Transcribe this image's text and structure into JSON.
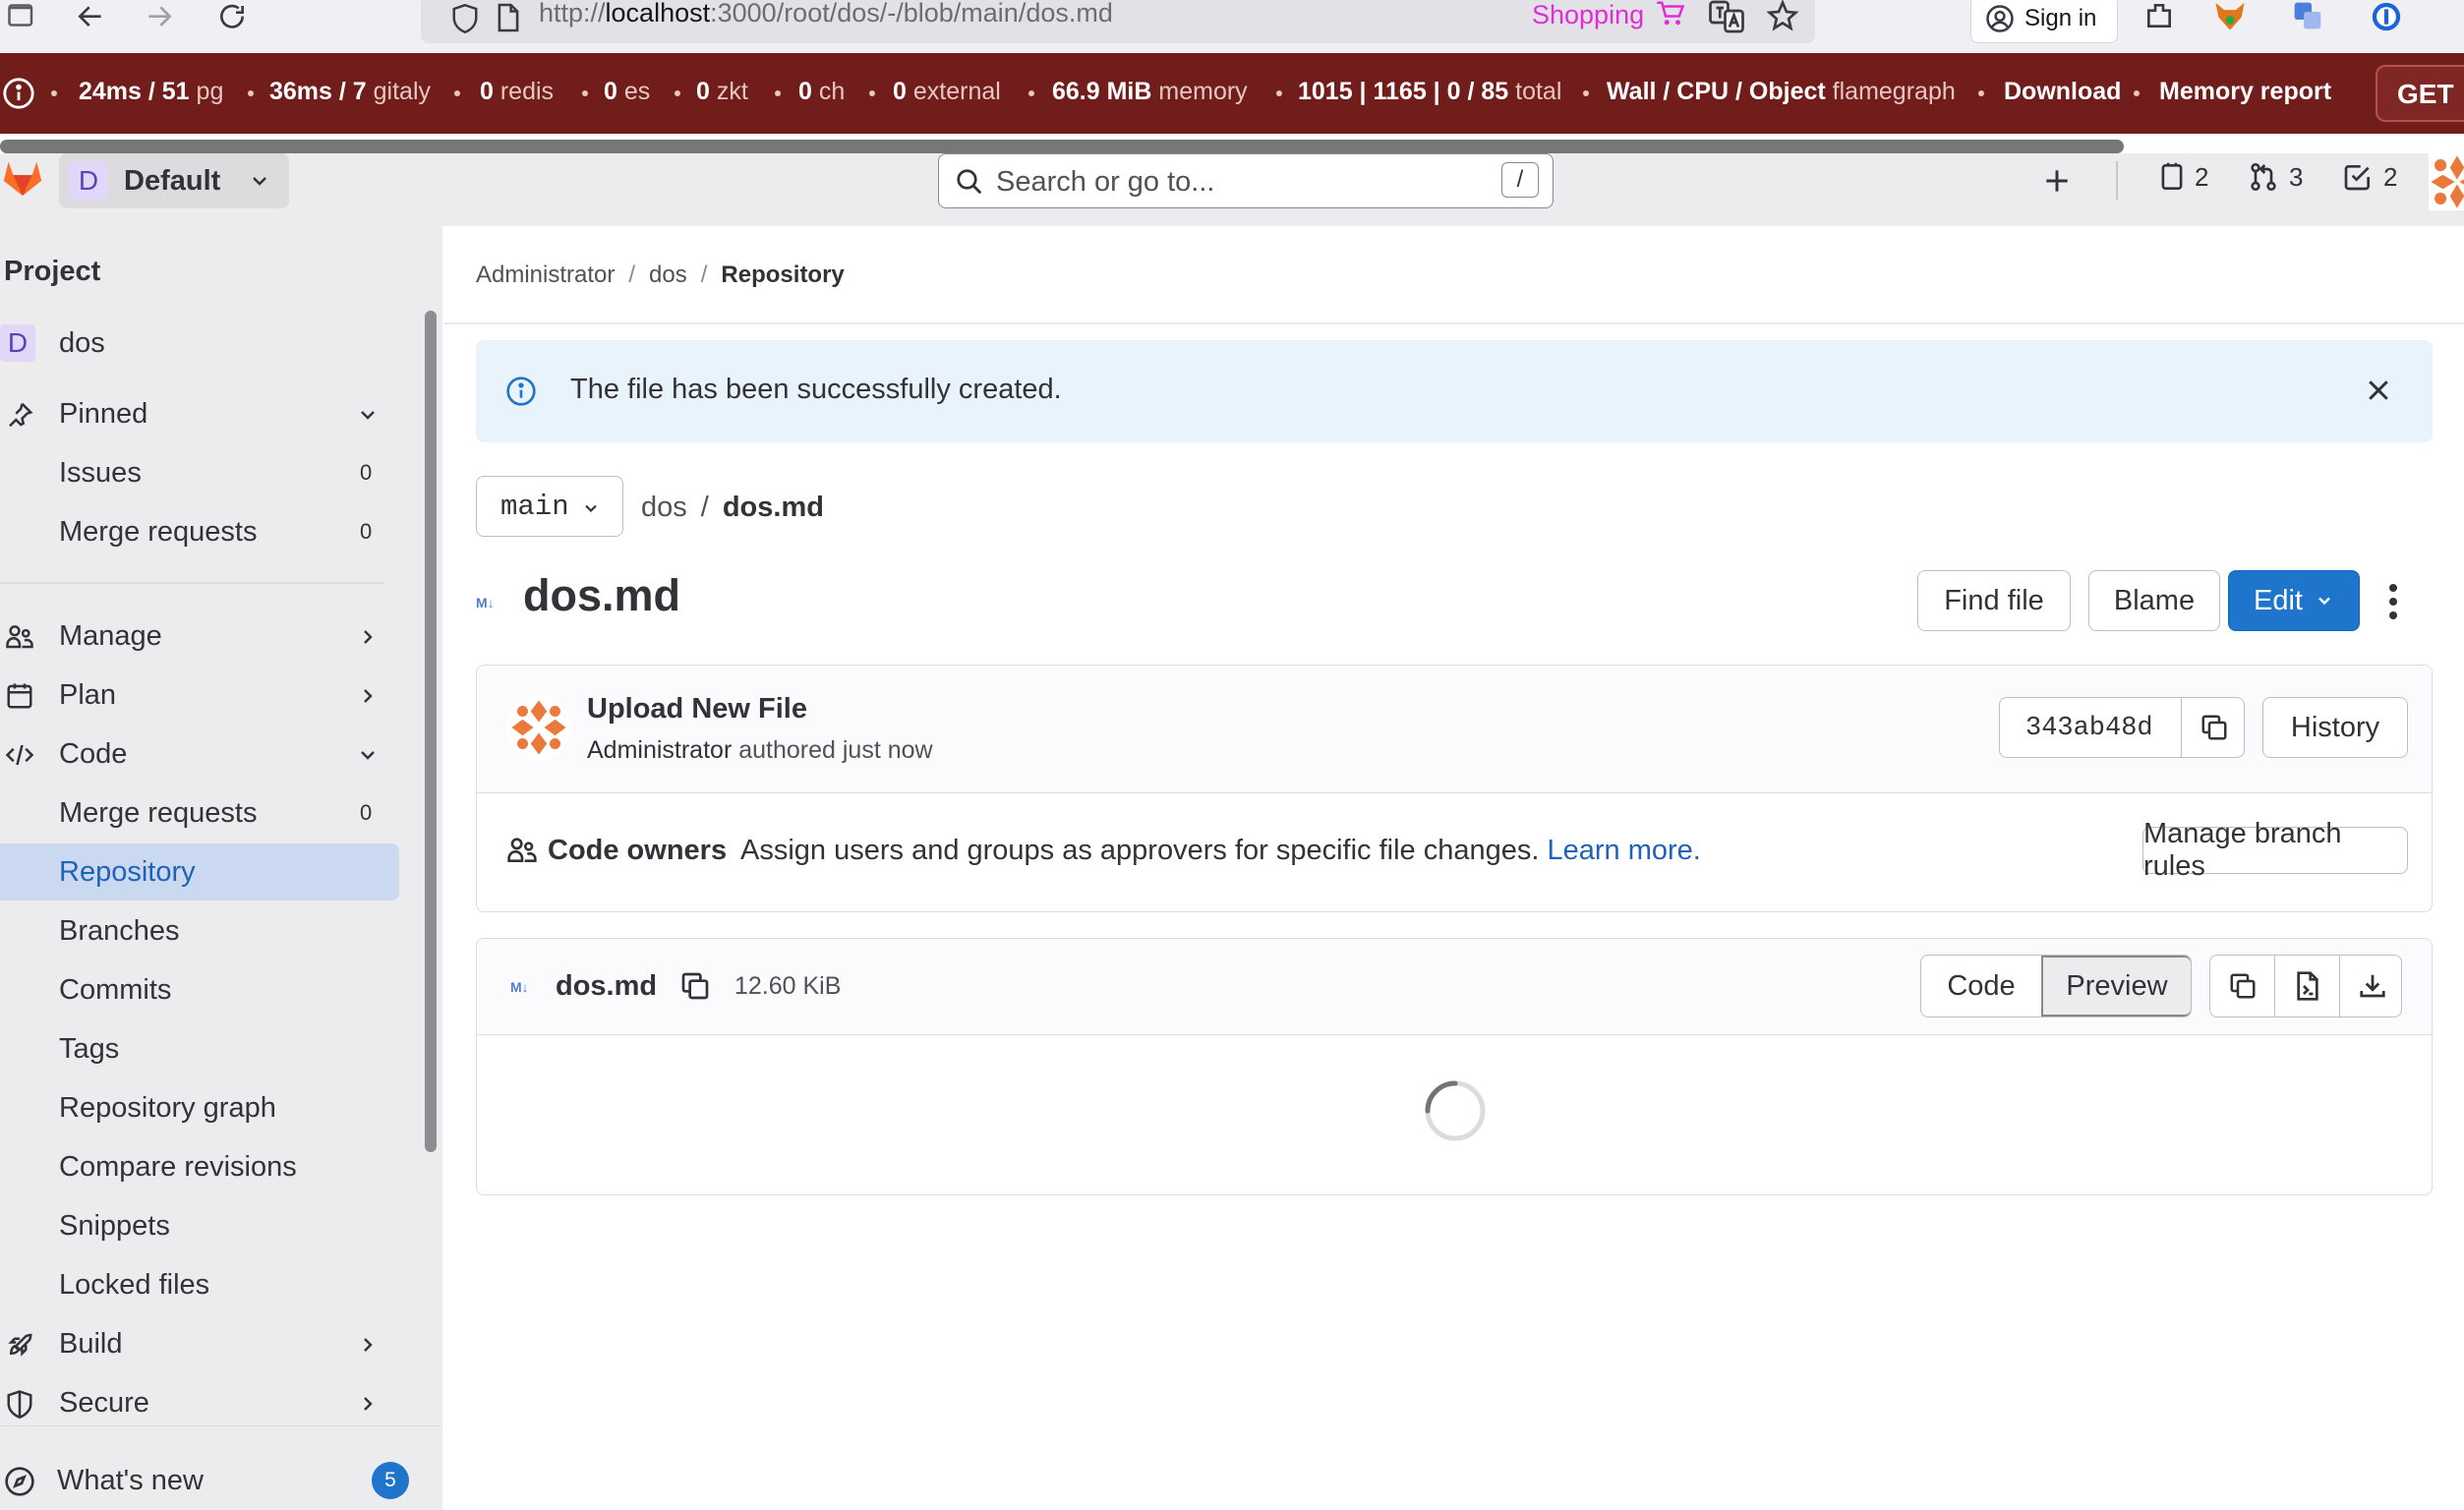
{
  "browser": {
    "url_prefix": "http://",
    "url_host": "localhost",
    "url_rest": ":3000/root/dos/-/blob/main/dos.md",
    "shopping_label": "Shopping",
    "signin_label": "Sign in"
  },
  "perf_bar": {
    "items": [
      {
        "bold": "24ms / 51",
        "muted": "pg"
      },
      {
        "bold": "36ms / 7",
        "muted": "gitaly"
      },
      {
        "bold": "0",
        "muted": "redis"
      },
      {
        "bold": "0",
        "muted": "es"
      },
      {
        "bold": "0",
        "muted": "zkt"
      },
      {
        "bold": "0",
        "muted": "ch"
      },
      {
        "bold": "0",
        "muted": "external"
      },
      {
        "bold": "66.9 MiB",
        "muted": "memory"
      },
      {
        "bold": "1015 | 1165 | 0 / 85",
        "muted": "total"
      },
      {
        "bold": "Wall / CPU / Object",
        "muted": "flamegraph"
      },
      {
        "bold": "Download",
        "muted": ""
      },
      {
        "bold": "Memory report",
        "muted": ""
      }
    ],
    "get_label": "GET"
  },
  "topbar": {
    "context_avatar": "D",
    "context_label": "Default",
    "search_placeholder": "Search or go to...",
    "search_shortcut": "/",
    "issues_count": "2",
    "mr_count": "3",
    "todo_count": "2"
  },
  "sidebar": {
    "heading": "Project",
    "project_avatar": "D",
    "project_name": "dos",
    "pinned_label": "Pinned",
    "pinned_items": [
      {
        "label": "Issues",
        "count": "0"
      },
      {
        "label": "Merge requests",
        "count": "0"
      }
    ],
    "sections": {
      "manage": "Manage",
      "plan": "Plan",
      "code": "Code",
      "build": "Build",
      "secure": "Secure"
    },
    "code_items": [
      {
        "label": "Merge requests",
        "count": "0"
      },
      {
        "label": "Repository",
        "count": ""
      },
      {
        "label": "Branches",
        "count": ""
      },
      {
        "label": "Commits",
        "count": ""
      },
      {
        "label": "Tags",
        "count": ""
      },
      {
        "label": "Repository graph",
        "count": ""
      },
      {
        "label": "Compare revisions",
        "count": ""
      },
      {
        "label": "Snippets",
        "count": ""
      },
      {
        "label": "Locked files",
        "count": ""
      }
    ],
    "whats_new_label": "What's new",
    "whats_new_count": "5"
  },
  "breadcrumb": {
    "items": [
      "Administrator",
      "dos"
    ],
    "current": "Repository"
  },
  "alert": {
    "message": "The file has been successfully created."
  },
  "file_nav": {
    "branch": "main",
    "path_dir": "dos",
    "path_file": "dos.md"
  },
  "file_title": {
    "name": "dos.md",
    "find_file": "Find file",
    "blame": "Blame",
    "edit": "Edit"
  },
  "commit": {
    "title": "Upload New File",
    "author": "Administrator",
    "authored_text": "authored just now",
    "sha": "343ab48d",
    "history_label": "History"
  },
  "code_owners": {
    "label": "Code owners",
    "description": "Assign users and groups as approvers for specific file changes.",
    "link_text": "Learn more.",
    "manage_rules": "Manage branch rules"
  },
  "file_viewer": {
    "name": "dos.md",
    "size": "12.60 KiB",
    "code_label": "Code",
    "preview_label": "Preview"
  },
  "colors": {
    "perf_bar_bg": "#701d1c",
    "primary": "#1f75cb",
    "link": "#1f63b8",
    "active_nav": "#cbd9f0",
    "alert_bg": "#e9f3fc",
    "tanuki_orange": "#fc6d26"
  }
}
